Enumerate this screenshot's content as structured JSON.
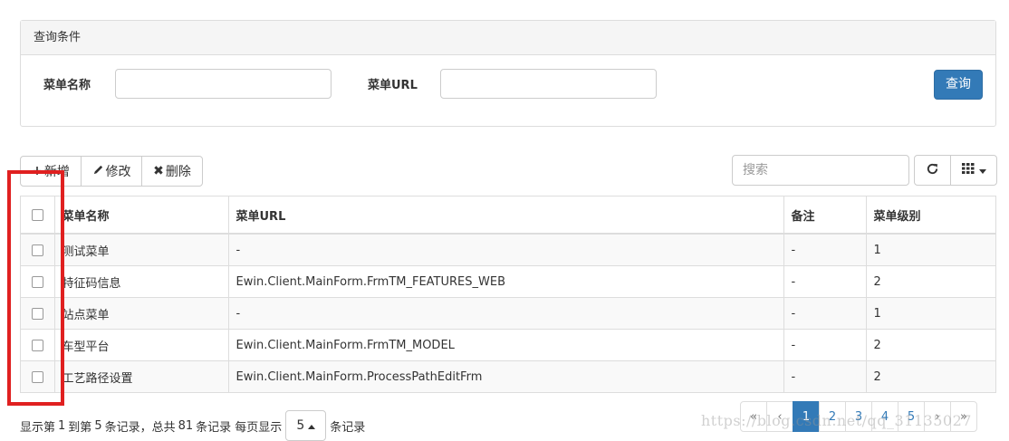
{
  "query_panel": {
    "title": "查询条件",
    "menu_name_label": "菜单名称",
    "menu_url_label": "菜单URL",
    "menu_name_value": "",
    "menu_url_value": "",
    "query_button": "查询"
  },
  "toolbar": {
    "add_label": "新增",
    "edit_label": "修改",
    "delete_label": "删除",
    "search_placeholder": "搜索",
    "refresh_icon": "refresh-icon",
    "columns_icon": "grid-columns-icon"
  },
  "table": {
    "headers": [
      "菜单名称",
      "菜单URL",
      "备注",
      "菜单级别"
    ],
    "rows": [
      {
        "name": "测试菜单",
        "url": "-",
        "remark": "-",
        "level": "1"
      },
      {
        "name": "特征码信息",
        "url": "Ewin.Client.MainForm.FrmTM_FEATURES_WEB",
        "remark": "-",
        "level": "2"
      },
      {
        "name": "站点菜单",
        "url": "-",
        "remark": "-",
        "level": "1"
      },
      {
        "name": "车型平台",
        "url": "Ewin.Client.MainForm.FrmTM_MODEL",
        "remark": "-",
        "level": "2"
      },
      {
        "name": "工艺路径设置",
        "url": "Ewin.Client.MainForm.ProcessPathEditFrm",
        "remark": "-",
        "level": "2"
      }
    ]
  },
  "footer": {
    "info_prefix": "显示第",
    "from": "1",
    "to_text": "到第",
    "to": "5",
    "records_text": "条记录，总共",
    "total": "81",
    "total_text": "条记录 每页显示",
    "page_size": "5",
    "page_size_suffix": "条记录",
    "pagination": {
      "first": "«",
      "prev": "‹",
      "pages": [
        "1",
        "2",
        "3",
        "4",
        "5"
      ],
      "active_page": "1",
      "next": "›",
      "last": "»"
    }
  },
  "watermark": "https://blog.csdn.net/qq_31135027",
  "colors": {
    "primary": "#337ab7",
    "annotation": "#e02020"
  }
}
